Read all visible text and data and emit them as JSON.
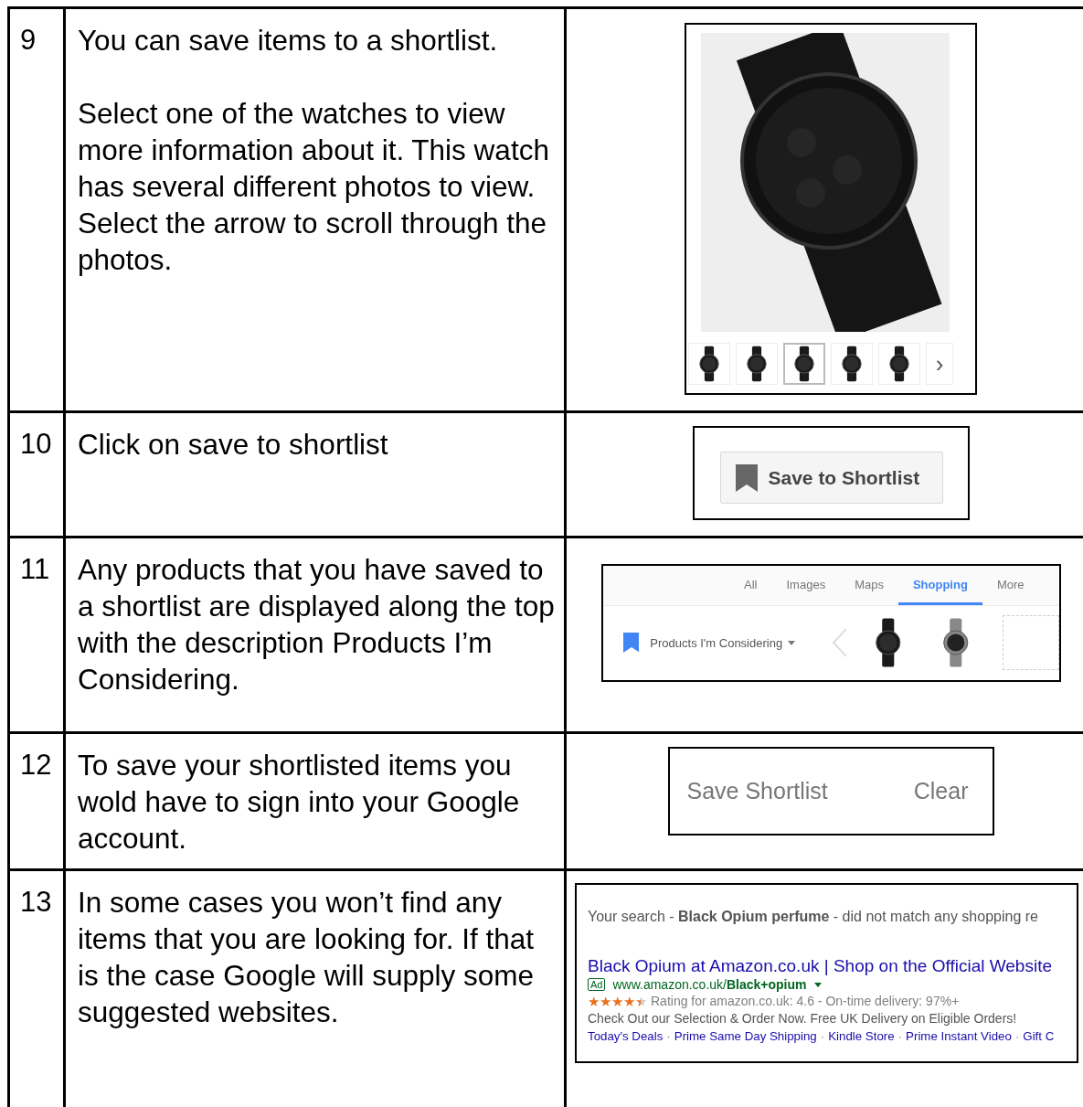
{
  "steps": [
    {
      "number": "9",
      "paragraphs": [
        "You can save items to a shortlist.",
        "Select one of the watches to view more information about it. This watch has several different photos to view. Select the arrow to scroll through the photos."
      ],
      "panel": {
        "kind": "gallery",
        "thumbnails": [
          {
            "selected": false
          },
          {
            "selected": false
          },
          {
            "selected": true
          },
          {
            "selected": false
          },
          {
            "selected": false
          }
        ],
        "next": "›"
      }
    },
    {
      "number": "10",
      "paragraphs": [
        "Click on save to shortlist"
      ],
      "panel": {
        "kind": "save_button",
        "label": "Save to Shortlist"
      }
    },
    {
      "number": "11",
      "paragraphs": [
        "Any products that you have saved to a shortlist are displayed along the top with the description Products I’m Considering."
      ],
      "panel": {
        "kind": "shortlist_bar",
        "tabs": [
          {
            "label": "All",
            "selected": false
          },
          {
            "label": "Images",
            "selected": false
          },
          {
            "label": "Maps",
            "selected": false
          },
          {
            "label": "Shopping",
            "selected": true
          },
          {
            "label": "More",
            "selected": false
          }
        ],
        "label": "Products I'm Considering"
      }
    },
    {
      "number": "12",
      "paragraphs": [
        "To save your shortlisted items you wold have to sign into your Google account."
      ],
      "panel": {
        "kind": "shortlist_actions",
        "buttons": [
          "Save Shortlist",
          "Clear"
        ]
      }
    },
    {
      "number": "13",
      "paragraphs": [
        "In some cases you won’t find any items that you are looking for. If that is the case Google will supply some suggested websites."
      ],
      "panel": {
        "kind": "no_results",
        "message": "Your search - **Black Opium perfume** - did not match any shopping re",
        "ad_title": "Black Opium at Amazon.co.uk | Shop on the Official Website",
        "ad_badge": "Ad",
        "ad_url": "www.amazon.co.uk/**Black+opium**",
        "stars": 4.5,
        "rating": "Rating for amazon.co.uk: 4.6 - On-time delivery: 97%+",
        "description": "Check Out our Selection & Order Now. Free UK Delivery on Eligible Orders!",
        "separator": "·",
        "sitelinks": [
          "Today's Deals",
          "Prime Same Day Shipping",
          "Kindle Store",
          "Prime Instant Video",
          "Gift C"
        ]
      }
    }
  ]
}
